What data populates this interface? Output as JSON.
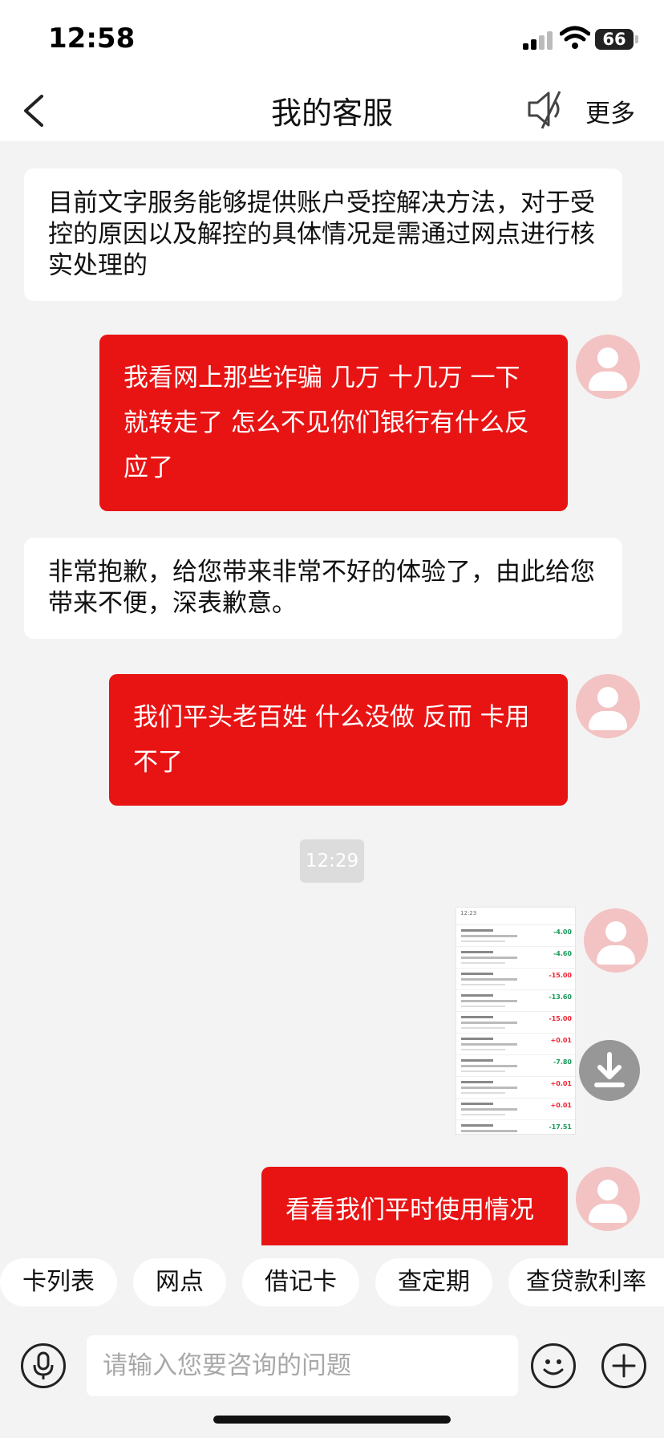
{
  "status": {
    "time": "12:58",
    "battery": "66"
  },
  "nav": {
    "title": "我的客服",
    "more": "更多"
  },
  "messages": [
    {
      "from": "agent",
      "text": "目前文字服务能够提供账户受控解决方法，对于受控的原因以及解控的具体情况是需通过网点进行核实处理的"
    },
    {
      "from": "user",
      "text": "我看网上那些诈骗 几万 十几万 一下就转走了 怎么不见你们银行有什么反应了"
    },
    {
      "from": "agent",
      "text": "非常抱歉，给您带来非常不好的体验了，由此给您带来不便，深表歉意。"
    },
    {
      "from": "user",
      "text": "我们平头老百姓 什么没做 反而 卡用不了"
    },
    {
      "from": "timestamp",
      "text": "12:29"
    },
    {
      "from": "user",
      "type": "image"
    },
    {
      "from": "user",
      "text": "看看我们平时使用情况"
    }
  ],
  "thumbnail": {
    "time": "12:23",
    "amounts": [
      "-4.00",
      "-4.60",
      "-15.00",
      "-13.60",
      "-15.00",
      "+0.01",
      "-7.80",
      "+0.01",
      "+0.01",
      "-17.51"
    ]
  },
  "colors": {
    "brand_red": "#e81414",
    "avatar_pink": "#f3c3c3"
  },
  "quick_replies": [
    "卡列表",
    "网点",
    "借记卡",
    "查定期",
    "查贷款利率"
  ],
  "input": {
    "placeholder": "请输入您要咨询的问题"
  },
  "icons": [
    "back-icon",
    "mute-icon",
    "avatar-icon",
    "scroll-down-icon",
    "mic-icon",
    "emoji-icon",
    "plus-icon"
  ]
}
